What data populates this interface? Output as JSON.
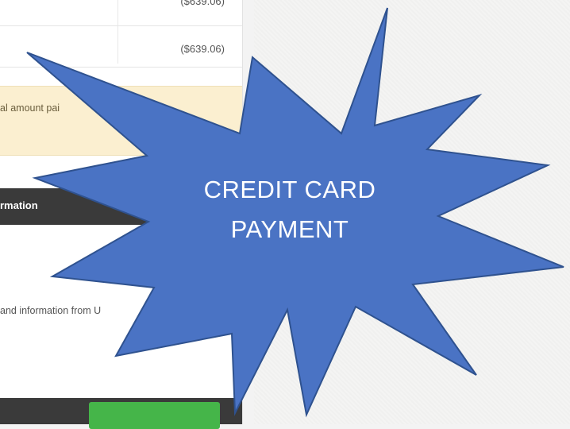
{
  "payments": {
    "rows": [
      {
        "amount": "($639.06)"
      },
      {
        "amount": "($639.06)"
      }
    ]
  },
  "notice": {
    "text": "al amount pai"
  },
  "section": {
    "header": "rmation"
  },
  "content": {
    "text": " and information from U"
  },
  "callout": {
    "line1": "CREDIT CARD",
    "line2": "PAYMENT",
    "fill_color": "#4a73c4",
    "stroke_color": "#2f528f"
  },
  "colors": {
    "button": "#45b549",
    "dark_bar": "#3a3a3a",
    "notice_bg": "#fbefd0"
  }
}
